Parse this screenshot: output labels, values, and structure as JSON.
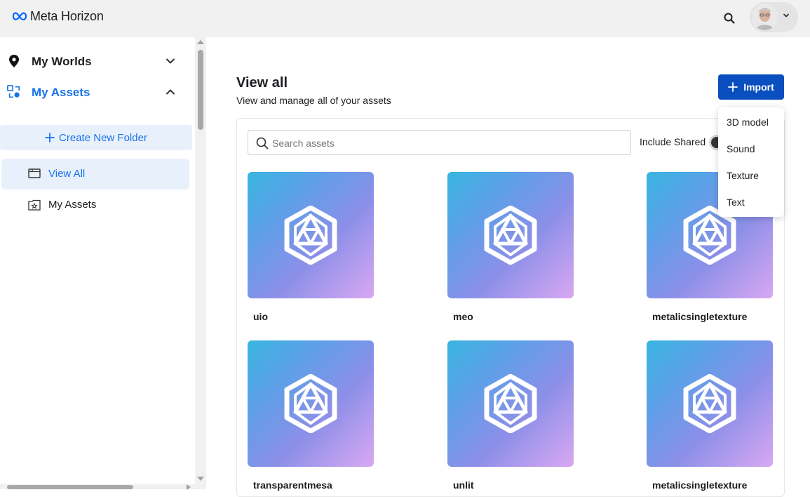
{
  "header": {
    "logo_text": "Meta Horizon",
    "avatar_alt": ""
  },
  "sidebar": {
    "sections": [
      {
        "label": "My Worlds",
        "icon": "location-pin-icon",
        "expanded": false
      },
      {
        "label": "My Assets",
        "icon": "assets-icon",
        "expanded": true
      }
    ],
    "create_folder_label": "Create New Folder",
    "folders": [
      {
        "label": "View All",
        "icon": "folder-icon",
        "active": true
      },
      {
        "label": "My Assets",
        "icon": "star-folder-icon",
        "active": false
      }
    ]
  },
  "main": {
    "title": "View all",
    "subtitle": "View and manage all of your assets",
    "import_label": "Import",
    "search_placeholder": "Search assets",
    "include_shared_label": "Include Shared",
    "include_shared_on": true
  },
  "import_menu": {
    "items": [
      "3D model",
      "Sound",
      "Texture",
      "Text"
    ]
  },
  "assets": [
    {
      "name": "uio"
    },
    {
      "name": "meo"
    },
    {
      "name": "metalicsingletexture"
    },
    {
      "name": "transparentmesa"
    },
    {
      "name": "unlit"
    },
    {
      "name": "metalicsingletexture"
    }
  ],
  "colors": {
    "accent": "#1a73e8",
    "import_button": "#0a4fbf",
    "thumbnail_gradient": [
      "#38b5e0",
      "#8c8fe8",
      "#d9a8f2"
    ]
  }
}
